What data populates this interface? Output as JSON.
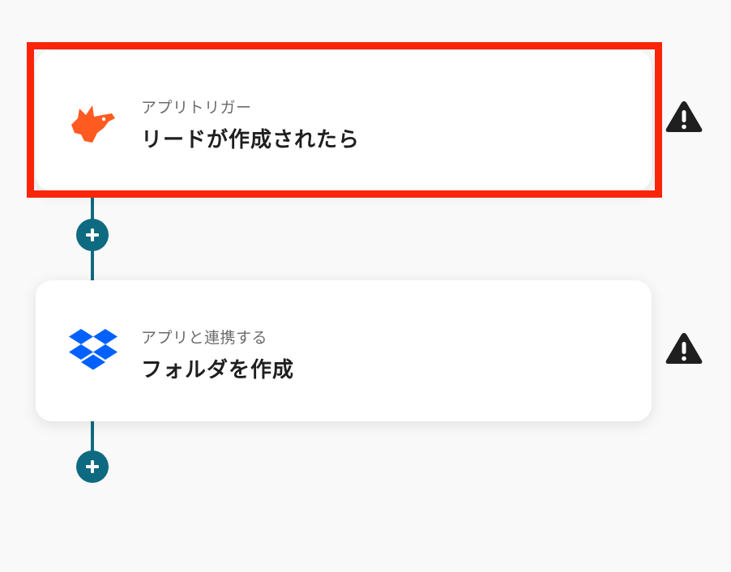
{
  "steps": [
    {
      "subtitle": "アプリトリガー",
      "title": "リードが作成されたら",
      "app_icon": "fox-icon",
      "status_icon": "warning-icon",
      "highlighted": true
    },
    {
      "subtitle": "アプリと連携する",
      "title": "フォルダを作成",
      "app_icon": "dropbox-icon",
      "status_icon": "warning-icon",
      "highlighted": false
    }
  ],
  "add_buttons": [
    {
      "icon": "plus-icon"
    },
    {
      "icon": "plus-icon"
    }
  ],
  "colors": {
    "background": "#f9f9f9",
    "connector": "#0e6a80",
    "highlight": "#fa2508",
    "fox": "#ff5a1f",
    "dropbox": "#0061fe",
    "warning": "#1f1f1f"
  }
}
